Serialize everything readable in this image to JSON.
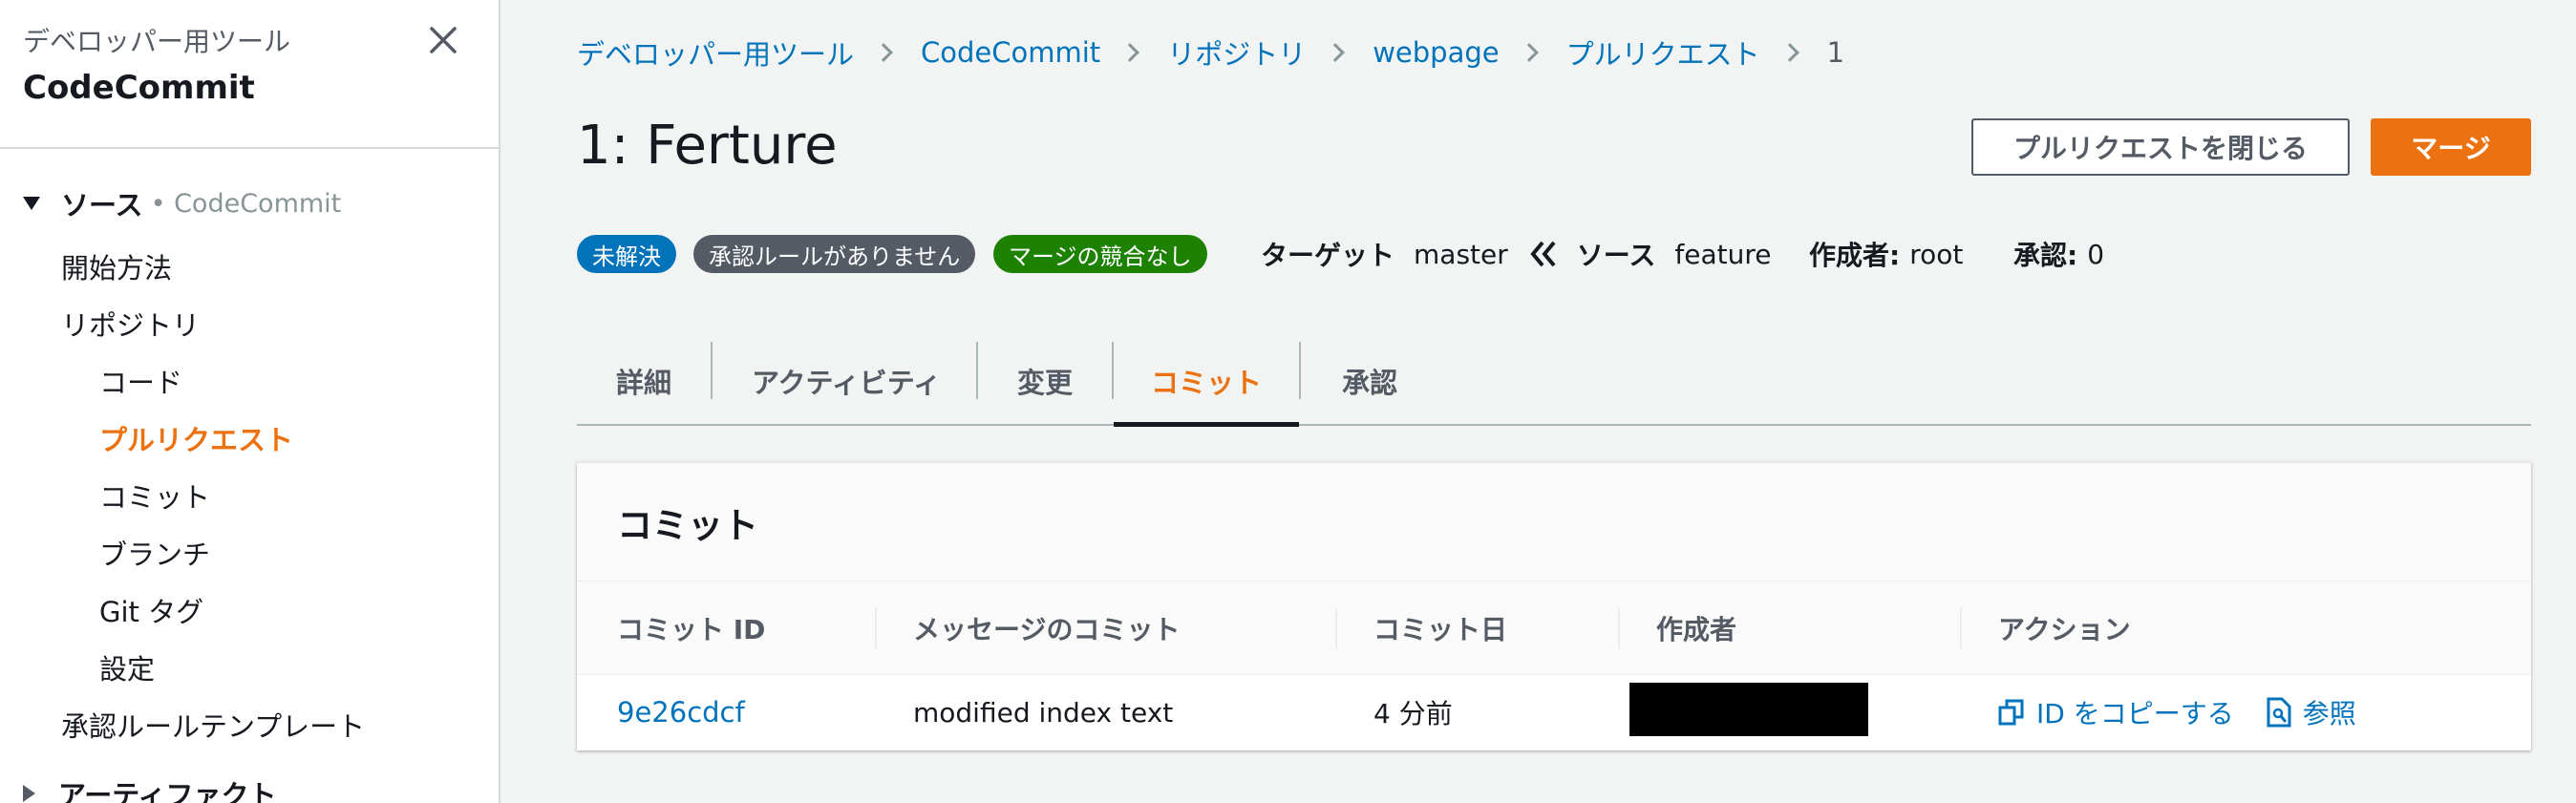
{
  "sidebar": {
    "subtitle": "デベロッパー用ツール",
    "title": "CodeCommit",
    "section": "ソース",
    "section_service": "• CodeCommit",
    "items": [
      {
        "label": "開始方法"
      },
      {
        "label": "リポジトリ"
      },
      {
        "label": "コード"
      },
      {
        "label": "プルリクエスト"
      },
      {
        "label": "コミット"
      },
      {
        "label": "ブランチ"
      },
      {
        "label": "Git タグ"
      },
      {
        "label": "設定"
      },
      {
        "label": "承認ルールテンプレート"
      }
    ],
    "section2": "アーティファクト"
  },
  "breadcrumb": [
    "デベロッパー用ツール",
    "CodeCommit",
    "リポジトリ",
    "webpage",
    "プルリクエスト",
    "1"
  ],
  "header": {
    "title": "1: Ferture",
    "close_pr_label": "プルリクエストを閉じる",
    "merge_label": "マージ"
  },
  "status": {
    "badge_open": "未解決",
    "badge_rules": "承認ルールがありません",
    "badge_conflict": "マージの競合なし",
    "target_label": "ターゲット",
    "target_value": "master",
    "source_label": "ソース",
    "source_value": "feature",
    "author_label": "作成者:",
    "author_value": "root",
    "approval_label": "承認:",
    "approval_value": "0"
  },
  "tabs": [
    "詳細",
    "アクティビティ",
    "変更",
    "コミット",
    "承認"
  ],
  "commits_panel": {
    "title": "コミット",
    "columns": [
      "コミット ID",
      "メッセージのコミット",
      "コミット日",
      "作成者",
      "アクション"
    ],
    "rows": [
      {
        "id": "9e26cdcf",
        "message": "modified index text",
        "date": "4 分前",
        "copy_label": "ID をコピーする",
        "browse_label": "参照"
      }
    ]
  },
  "colors": {
    "accent": "#ec7211",
    "link": "#0073bb",
    "badge_open": "#0073bb",
    "badge_rules": "#545b64",
    "badge_conflict": "#1d8102"
  }
}
